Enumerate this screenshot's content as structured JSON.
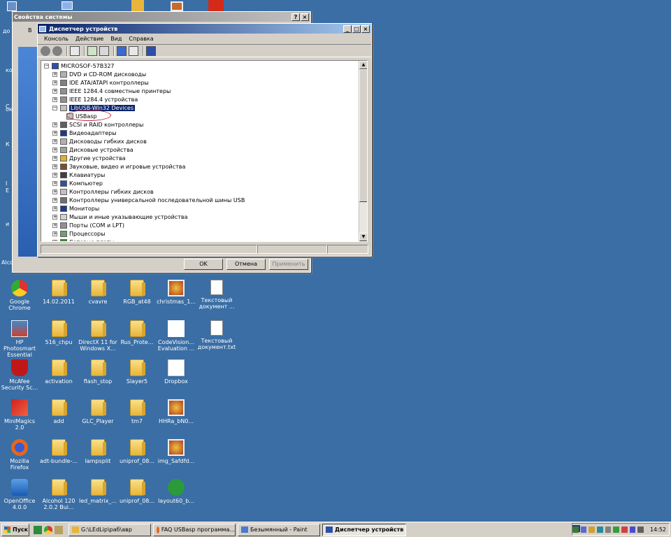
{
  "colors": {
    "desktop": "#3a6ea5",
    "title_active": "#0a246a",
    "title_inactive": "#808080",
    "selection": "#0a246a"
  },
  "back_window": {
    "title": "Свойства системы",
    "help": "?",
    "close": "×",
    "tab_fragment": "В",
    "ok": "OK",
    "cancel": "Отмена",
    "apply": "Применить"
  },
  "devmgr": {
    "title": "Диспетчер устройств",
    "menu": [
      "Консоль",
      "Действие",
      "Вид",
      "Справка"
    ],
    "root": "MICROSOF-57B327",
    "items": [
      {
        "label": "DVD и CD-ROM дисководы",
        "exp": "+",
        "level": 1
      },
      {
        "label": "IDE ATA/ATAPI контроллеры",
        "exp": "+",
        "level": 1
      },
      {
        "label": "IEEE 1284.4 совместные принтеры",
        "exp": "+",
        "level": 1
      },
      {
        "label": "IEEE 1284.4 устройства",
        "exp": "+",
        "level": 1
      },
      {
        "label": "LibUSB-Win32 Devices",
        "exp": "−",
        "level": 1,
        "selected": true
      },
      {
        "label": "USBasp",
        "exp": "",
        "level": 2
      },
      {
        "label": "SCSI и RAID контроллеры",
        "exp": "+",
        "level": 1
      },
      {
        "label": "Видеоадаптеры",
        "exp": "+",
        "level": 1
      },
      {
        "label": "Дисководы гибких дисков",
        "exp": "+",
        "level": 1
      },
      {
        "label": "Дисковые устройства",
        "exp": "+",
        "level": 1
      },
      {
        "label": "Другие устройства",
        "exp": "+",
        "level": 1
      },
      {
        "label": "Звуковые, видео и игровые устройства",
        "exp": "+",
        "level": 1
      },
      {
        "label": "Клавиатуры",
        "exp": "+",
        "level": 1
      },
      {
        "label": "Компьютер",
        "exp": "+",
        "level": 1
      },
      {
        "label": "Контроллеры гибких дисков",
        "exp": "+",
        "level": 1
      },
      {
        "label": "Контроллеры универсальной последовательной шины USB",
        "exp": "+",
        "level": 1
      },
      {
        "label": "Мониторы",
        "exp": "+",
        "level": 1
      },
      {
        "label": "Мыши и иные указывающие устройства",
        "exp": "+",
        "level": 1
      },
      {
        "label": "Порты (COM и LPT)",
        "exp": "+",
        "level": 1
      },
      {
        "label": "Процессоры",
        "exp": "+",
        "level": 1
      },
      {
        "label": "Сетевые платы",
        "exp": "+",
        "level": 1
      }
    ]
  },
  "left_edge_texts": [
    "до",
    "кол",
    "С",
    "ок",
    "К",
    "І",
    "Е",
    "и",
    "Alco"
  ],
  "desktop_icons": [
    {
      "label": "Google Chrome",
      "type": "chrome"
    },
    {
      "label": "14.02.2011",
      "type": "folder"
    },
    {
      "label": "cvavre",
      "type": "folder"
    },
    {
      "label": "RGB_at48",
      "type": "folder"
    },
    {
      "label": "christmas_1...",
      "type": "image"
    },
    {
      "label": "Текстовый документ ...",
      "type": "doc"
    },
    {
      "label": "HP Photosmart Essential",
      "type": "hp"
    },
    {
      "label": "516_chpu",
      "type": "folder"
    },
    {
      "label": "DirectX 11 for Windows X...",
      "type": "folder"
    },
    {
      "label": "Rus_Prote...",
      "type": "folder"
    },
    {
      "label": "CodeVision... Evaluation ...",
      "type": "cv"
    },
    {
      "label": "Текстовый документ.txt",
      "type": "doc"
    },
    {
      "label": "McAfee Security Sc...",
      "type": "mcafee"
    },
    {
      "label": "activation",
      "type": "folder"
    },
    {
      "label": "flash_stop",
      "type": "folder"
    },
    {
      "label": "Slayer5",
      "type": "folder"
    },
    {
      "label": "Dropbox",
      "type": "dropbox"
    },
    {
      "label": "",
      "type": "none"
    },
    {
      "label": "MiniMagics 2.0",
      "type": "mini"
    },
    {
      "label": "add",
      "type": "folder"
    },
    {
      "label": "GLC_Player",
      "type": "folder"
    },
    {
      "label": "tm7",
      "type": "folder"
    },
    {
      "label": "HHRa_bN0...",
      "type": "image"
    },
    {
      "label": "",
      "type": "none"
    },
    {
      "label": "Mozilla Firefox",
      "type": "firefox"
    },
    {
      "label": "adt-bundle-...",
      "type": "folder"
    },
    {
      "label": "lampsplit",
      "type": "folder"
    },
    {
      "label": "uniprof_08...",
      "type": "folder"
    },
    {
      "label": "img_Safdfd...",
      "type": "image"
    },
    {
      "label": "",
      "type": "none"
    },
    {
      "label": "OpenOffice 4.0.0",
      "type": "oo"
    },
    {
      "label": "Alcohol 120 2.0.2 Bui...",
      "type": "folder"
    },
    {
      "label": "led_matrix_...",
      "type": "folder"
    },
    {
      "label": "uniprof_08...",
      "type": "folder"
    },
    {
      "label": "layout60_b...",
      "type": "layout"
    },
    {
      "label": "",
      "type": "none"
    }
  ],
  "taskbar": {
    "start": "Пуск",
    "tasks": [
      "G:\\LEdLip\\раб\\авр",
      "FAQ USBasp программа...",
      "Безымянный - Paint",
      "Диспетчер устройств"
    ],
    "lang": "EN",
    "clock": "14:52"
  }
}
